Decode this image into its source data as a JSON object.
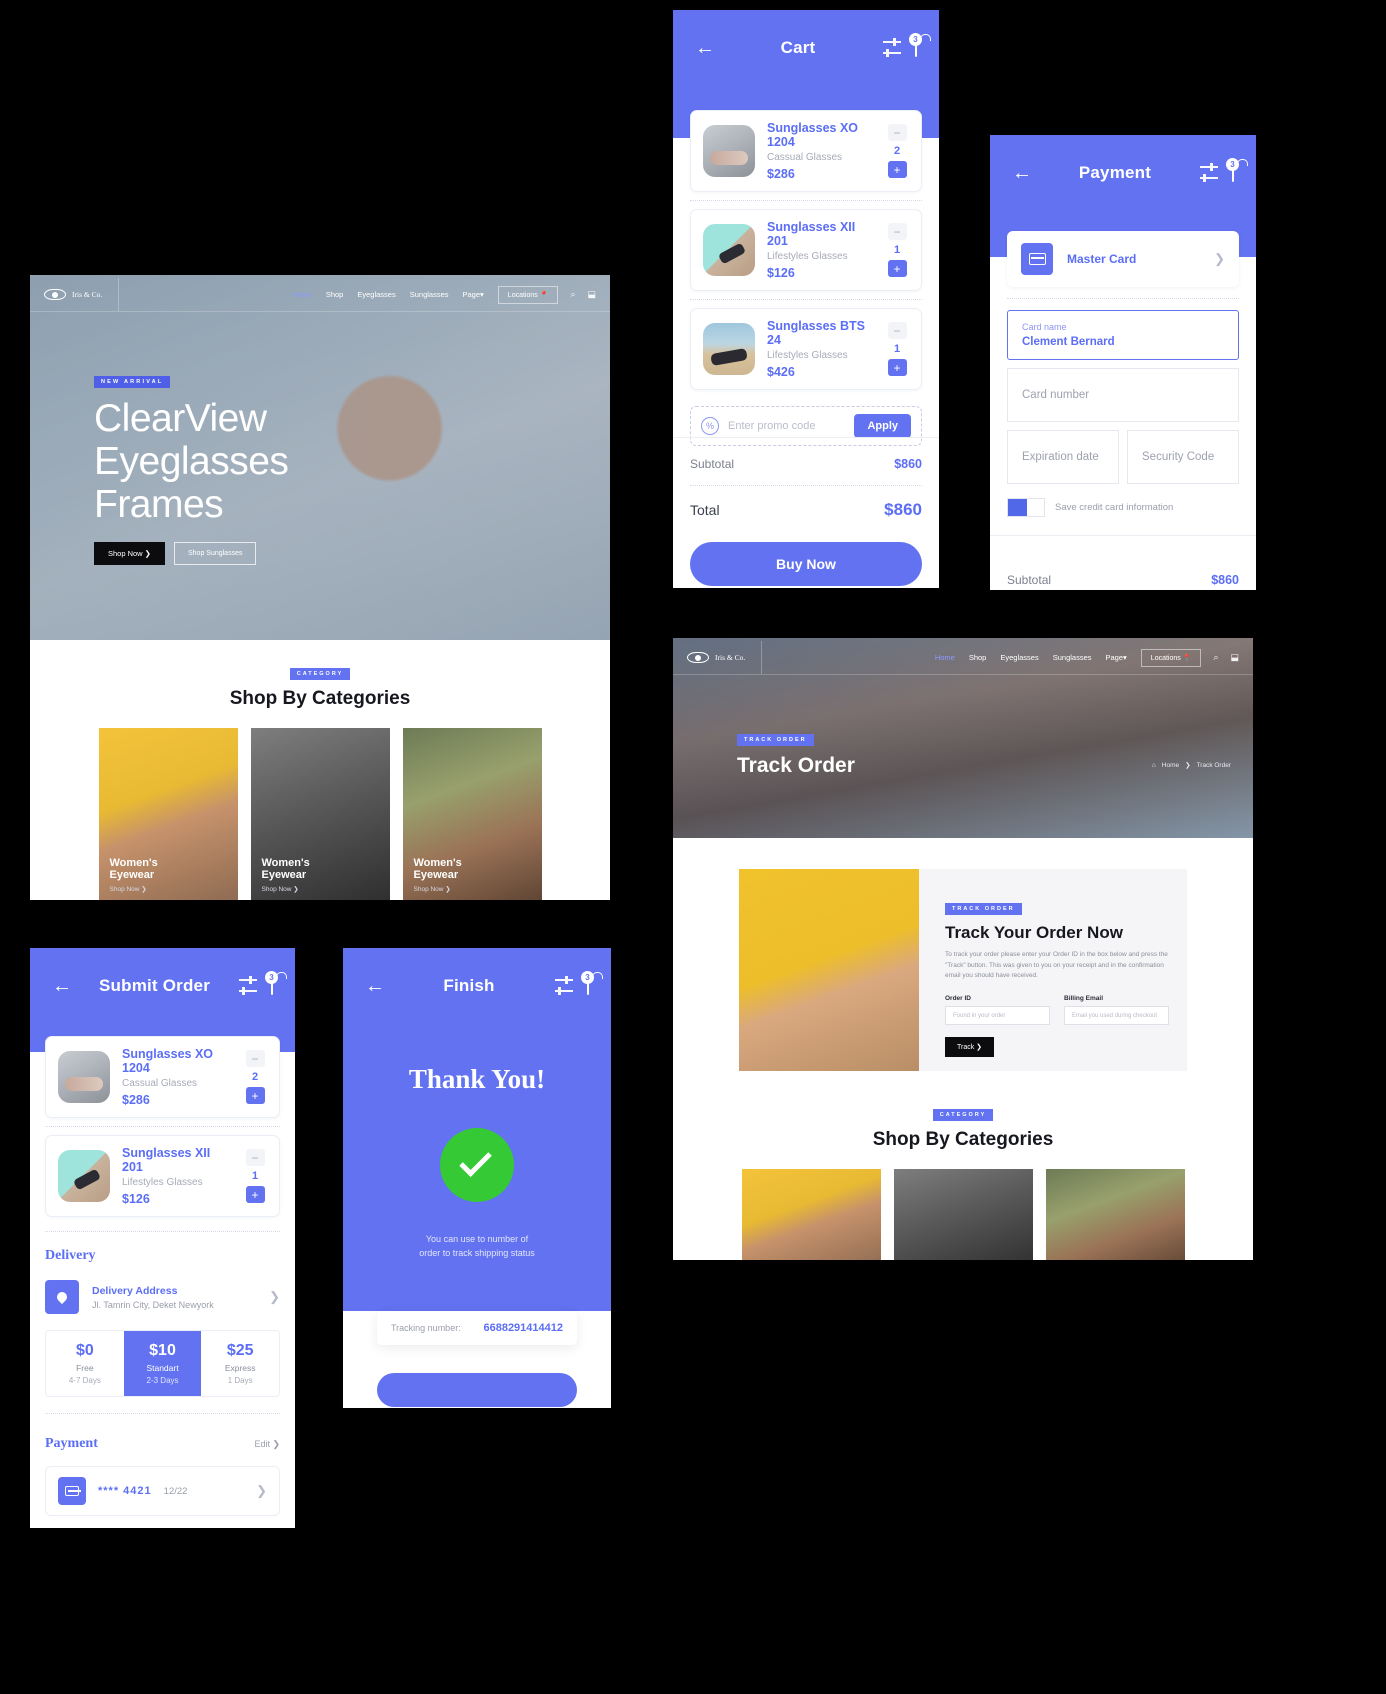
{
  "brand": {
    "accent": "#6272f0",
    "name": "Iris & Co."
  },
  "web_nav": {
    "links": [
      "Home",
      "Shop",
      "Eyeglasses",
      "Sunglasses",
      "Page"
    ],
    "page_caret": "▾",
    "locations_label": "Locations",
    "pin_icon": "📍",
    "search_icon": "search-icon",
    "bag_icon": "bag-icon"
  },
  "home": {
    "hero": {
      "badge": "NEW ARRIVAL",
      "title_lines": [
        "ClearView",
        "Eyeglasses",
        "Frames"
      ],
      "primary_button": "Shop Now  ❯",
      "secondary_button": "Shop Sunglasses"
    },
    "categories": {
      "badge": "CATEGORY",
      "heading": "Shop By Categories",
      "cards": [
        {
          "title_line1": "Women's",
          "title_line2": "Eyewear",
          "link": "Shop Now  ❯"
        },
        {
          "title_line1": "Women's",
          "title_line2": "Eyewear",
          "link": "Shop Now  ❯"
        },
        {
          "title_line1": "Women's",
          "title_line2": "Eyewear",
          "link": "Shop Now  ❯"
        }
      ]
    }
  },
  "cart_screen": {
    "header": {
      "back": "←",
      "title": "Cart",
      "filter_icon": "sliders-icon",
      "bag_icon": "bag-icon",
      "bag_badge": "3"
    },
    "items": [
      {
        "name": "Sunglasses XO 1204",
        "category": "Cassual Glasses",
        "price": "$286",
        "qty": "2",
        "minus": "−",
        "plus": "+"
      },
      {
        "name": "Sunglasses XII 201",
        "category": "Lifestyles Glasses",
        "price": "$126",
        "qty": "1",
        "minus": "−",
        "plus": "+"
      },
      {
        "name": "Sunglasses BTS 24",
        "category": "Lifestyles Glasses",
        "price": "$426",
        "qty": "1",
        "minus": "−",
        "plus": "+"
      }
    ],
    "promo": {
      "icon": "%",
      "placeholder": "Enter promo code",
      "apply": "Apply"
    },
    "subtotal_label": "Subtotal",
    "subtotal_value": "$860",
    "total_label": "Total",
    "total_value": "$860",
    "buy_button": "Buy Now"
  },
  "payment_screen": {
    "header": {
      "back": "←",
      "title": "Payment",
      "filter_icon": "sliders-icon",
      "bag_icon": "bag-icon",
      "bag_badge": "3"
    },
    "card_method": {
      "name": "Master Card",
      "chevron": "❯"
    },
    "fields": {
      "card_name_label": "Card name",
      "card_name_value": "Clement Bernard",
      "card_number_placeholder": "Card number",
      "expiration_placeholder": "Expiration date",
      "security_placeholder": "Security Code"
    },
    "save_toggle_label": "Save credit card information",
    "subtotal_label": "Subtotal",
    "subtotal_value": "$860"
  },
  "submit_order_screen": {
    "header": {
      "back": "←",
      "title": "Submit Order",
      "filter_icon": "sliders-icon",
      "bag_icon": "bag-icon",
      "bag_badge": "3"
    },
    "items": [
      {
        "name": "Sunglasses XO 1204",
        "category": "Cassual Glasses",
        "price": "$286",
        "qty": "2",
        "minus": "−",
        "plus": "+"
      },
      {
        "name": "Sunglasses XII 201",
        "category": "Lifestyles Glasses",
        "price": "$126",
        "qty": "1",
        "minus": "−",
        "plus": "+"
      }
    ],
    "delivery_title": "Delivery",
    "address": {
      "label": "Delivery Address",
      "value": "Jl. Tamrin City, Deket Newyork",
      "chevron": "❯",
      "icon": "location-pin-icon"
    },
    "shipping_options": [
      {
        "price": "$0",
        "name": "Free",
        "days": "4-7 Days",
        "selected": false
      },
      {
        "price": "$10",
        "name": "Standart",
        "days": "2-3 Days",
        "selected": true
      },
      {
        "price": "$25",
        "name": "Express",
        "days": "1 Days",
        "selected": false
      }
    ],
    "payment_title": "Payment",
    "payment_edit": "Edit ❯",
    "payment_card": {
      "number": "**** 4421",
      "expiry": "12/22",
      "chevron": "❯"
    }
  },
  "finish_screen": {
    "header": {
      "back": "←",
      "title": "Finish",
      "filter_icon": "sliders-icon",
      "bag_icon": "bag-icon",
      "bag_badge": "3"
    },
    "title": "Thank You!",
    "check_icon": "check-circle-icon",
    "note_line1": "You can use to number of",
    "note_line2": "order to track shipping status",
    "tracking_label": "Tracking number:",
    "tracking_value": "6688291414412"
  },
  "track_order_page": {
    "hero": {
      "badge": "TRACK ORDER",
      "title": "Track Order",
      "breadcrumb_home": "Home",
      "breadcrumb_sep": "❯",
      "breadcrumb_current": "Track Order",
      "home_icon": "home-icon"
    },
    "panel": {
      "badge": "TRACK ORDER",
      "heading": "Track Your Order Now",
      "paragraph": "To track your order please enter your Order ID in the box below and press the \"Track\" button. This was given to you on your receipt and in the confirmation email you should have received.",
      "order_id_label": "Order ID",
      "order_id_placeholder": "Found in your order",
      "billing_email_label": "Billing Email",
      "billing_email_placeholder": "Email you used during checkout",
      "track_button": "Track  ❯"
    },
    "categories": {
      "badge": "CATEGORY",
      "heading": "Shop By Categories"
    }
  }
}
